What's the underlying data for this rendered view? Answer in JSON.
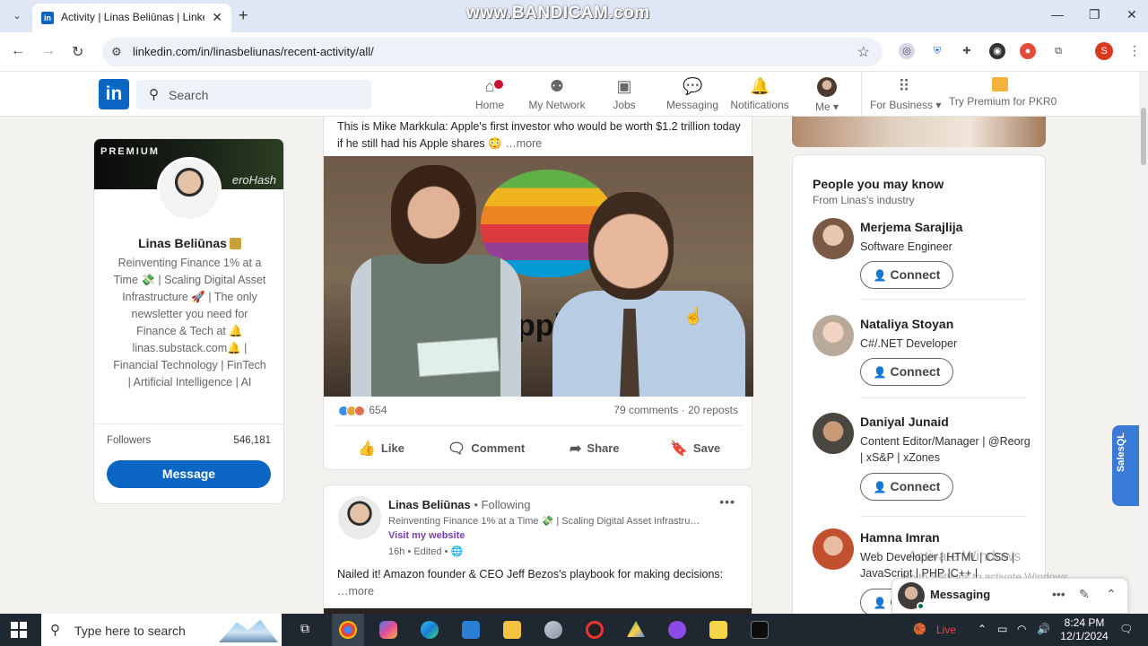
{
  "browser": {
    "tab_title": "Activity | Linas Beliūnas | Linked",
    "url": "linkedin.com/in/linasbeliunas/recent-activity/all/",
    "watermark": "www.BANDICAM.com",
    "profile_initial": "S"
  },
  "header": {
    "logo": "in",
    "search_placeholder": "Search",
    "nav": {
      "home": "Home",
      "my_network": "My Network",
      "jobs": "Jobs",
      "messaging": "Messaging",
      "notifications": "Notifications",
      "me": "Me",
      "for_business": "For Business",
      "premium": "Try Premium for PKR0"
    }
  },
  "profile": {
    "banner_label": "PREMIUM",
    "banner_brand": "eroHash",
    "name": "Linas Beliūnas",
    "headline": "Reinventing Finance 1% at a Time 💸 | Scaling Digital Asset Infrastructure 🚀 | The only newsletter you need for Finance & Tech at 🔔 linas.substack.com🔔 | Financial Technology | FinTech | Artificial Intelligence | AI",
    "followers_label": "Followers",
    "followers_count": "546,181",
    "message_label": "Message"
  },
  "post1": {
    "text": "This is Mike Markkula: Apple's first investor who would be worth $1.2 trillion today if he still had his Apple shares 😳",
    "more": "…more",
    "image_text": "pple",
    "reactions_count": "654",
    "stats": "79 comments · 20 reposts",
    "actions": {
      "like": "Like",
      "comment": "Comment",
      "share": "Share",
      "save": "Save"
    }
  },
  "post2": {
    "author": "Linas Beliūnas",
    "following": "• Following",
    "headline": "Reinventing Finance 1% at a Time 💸 | Scaling Digital Asset Infrastru…",
    "visit": "Visit my website",
    "time": "16h • Edited •",
    "text": "Nailed it! Amazon founder & CEO Jeff Bezos's playbook for making decisions:",
    "more": "…more"
  },
  "pymk": {
    "title": "People you may know",
    "subtitle": "From Linas's industry",
    "connect_label": "Connect",
    "people": [
      {
        "name": "Merjema Sarajlija",
        "title": "Software Engineer"
      },
      {
        "name": "Nataliya Stoyan",
        "title": "C#/.NET Developer"
      },
      {
        "name": "Daniyal Junaid",
        "title": "Content Editor/Manager | @Reorg | xS&P | xZones"
      },
      {
        "name": "Hamna Imran",
        "title": "Web Developer | HTML | CSS | JavaScript | PHP |C++ |"
      }
    ]
  },
  "salesql_label": "SalesQL",
  "windows_watermark": {
    "line1": "Activate Windows",
    "line2": "Go to Settings to activate Windows."
  },
  "messaging_bar": {
    "label": "Messaging"
  },
  "taskbar": {
    "search_placeholder": "Type here to search",
    "live": "Live",
    "time": "8:24 PM",
    "date": "12/1/2024"
  },
  "colors": {
    "linkedin_blue": "#0a66c2",
    "notification_red": "#cb112d",
    "premium_gold": "#f2b33d"
  }
}
